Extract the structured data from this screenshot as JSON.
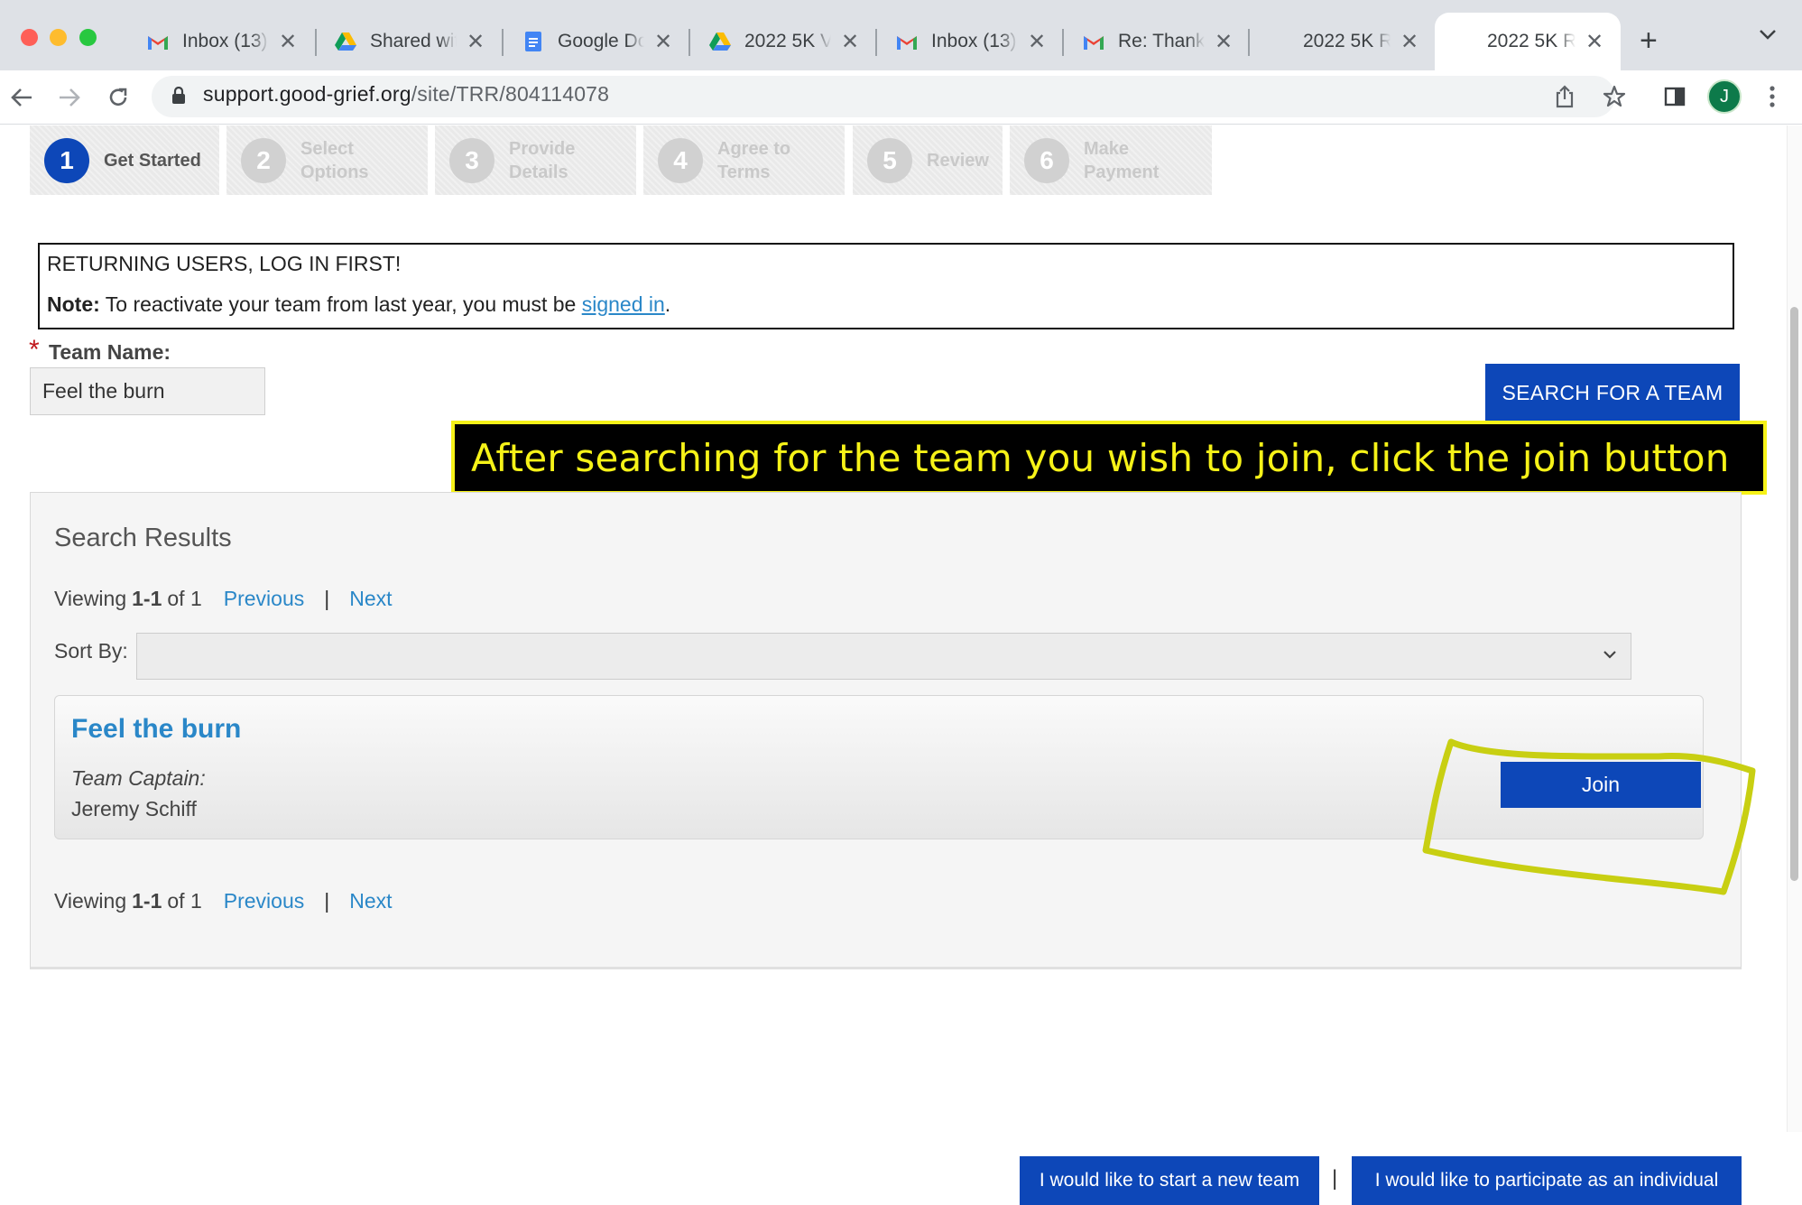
{
  "browser": {
    "tabs": [
      {
        "icon": "gmail-icon",
        "title": "Inbox (13)"
      },
      {
        "icon": "drive-icon",
        "title": "Shared wit"
      },
      {
        "icon": "docs-icon",
        "title": "Google Do"
      },
      {
        "icon": "drive-icon",
        "title": "2022 5K V"
      },
      {
        "icon": "gmail-icon",
        "title": "Inbox (13)"
      },
      {
        "icon": "gmail-icon",
        "title": "Re: Thank"
      },
      {
        "icon": "",
        "title": "2022 5K R"
      },
      {
        "icon": "",
        "title": "2022 5K R",
        "active": true
      }
    ],
    "url_host": "support.good-grief.org",
    "url_path": "/site/TRR/804114078",
    "avatar_initial": "J"
  },
  "steps": [
    {
      "num": "1",
      "label": "Get Started",
      "active": true
    },
    {
      "num": "2",
      "label": "Select Options"
    },
    {
      "num": "3",
      "label": "Provide Details"
    },
    {
      "num": "4",
      "label": "Agree to Terms"
    },
    {
      "num": "5",
      "label": "Review"
    },
    {
      "num": "6",
      "label": "Make Payment"
    }
  ],
  "notice": {
    "heading": "RETURNING USERS, LOG IN FIRST!",
    "note_label": "Note:",
    "note_text": " To reactivate your team from last year, you must be ",
    "link_text": "signed in",
    "note_end": "."
  },
  "team_form": {
    "required_mark": "*",
    "label": "Team Name:",
    "value": "Feel the burn",
    "search_button": "SEARCH FOR A TEAM"
  },
  "callout": "After searching for the team you wish to join, click the join button",
  "results": {
    "title": "Search Results",
    "viewing_prefix": "Viewing",
    "viewing_range": "1-1",
    "viewing_suffix": "of 1",
    "previous": "Previous",
    "separator": "|",
    "next": "Next",
    "sort_label": "Sort By:",
    "sort_value": "",
    "team": {
      "name": "Feel the burn",
      "captain_label": "Team Captain:",
      "captain_name": "Jeremy Schiff",
      "join_label": "Join"
    }
  },
  "footer": {
    "new_team": "I would like to start a new team",
    "separator": "|",
    "individual": "I would like to participate as an individual"
  },
  "colors": {
    "primary_button": "#0d47b8",
    "link": "#2a87c8",
    "callout_text": "#f6f218",
    "highlight_circle": "#c8cf12"
  }
}
